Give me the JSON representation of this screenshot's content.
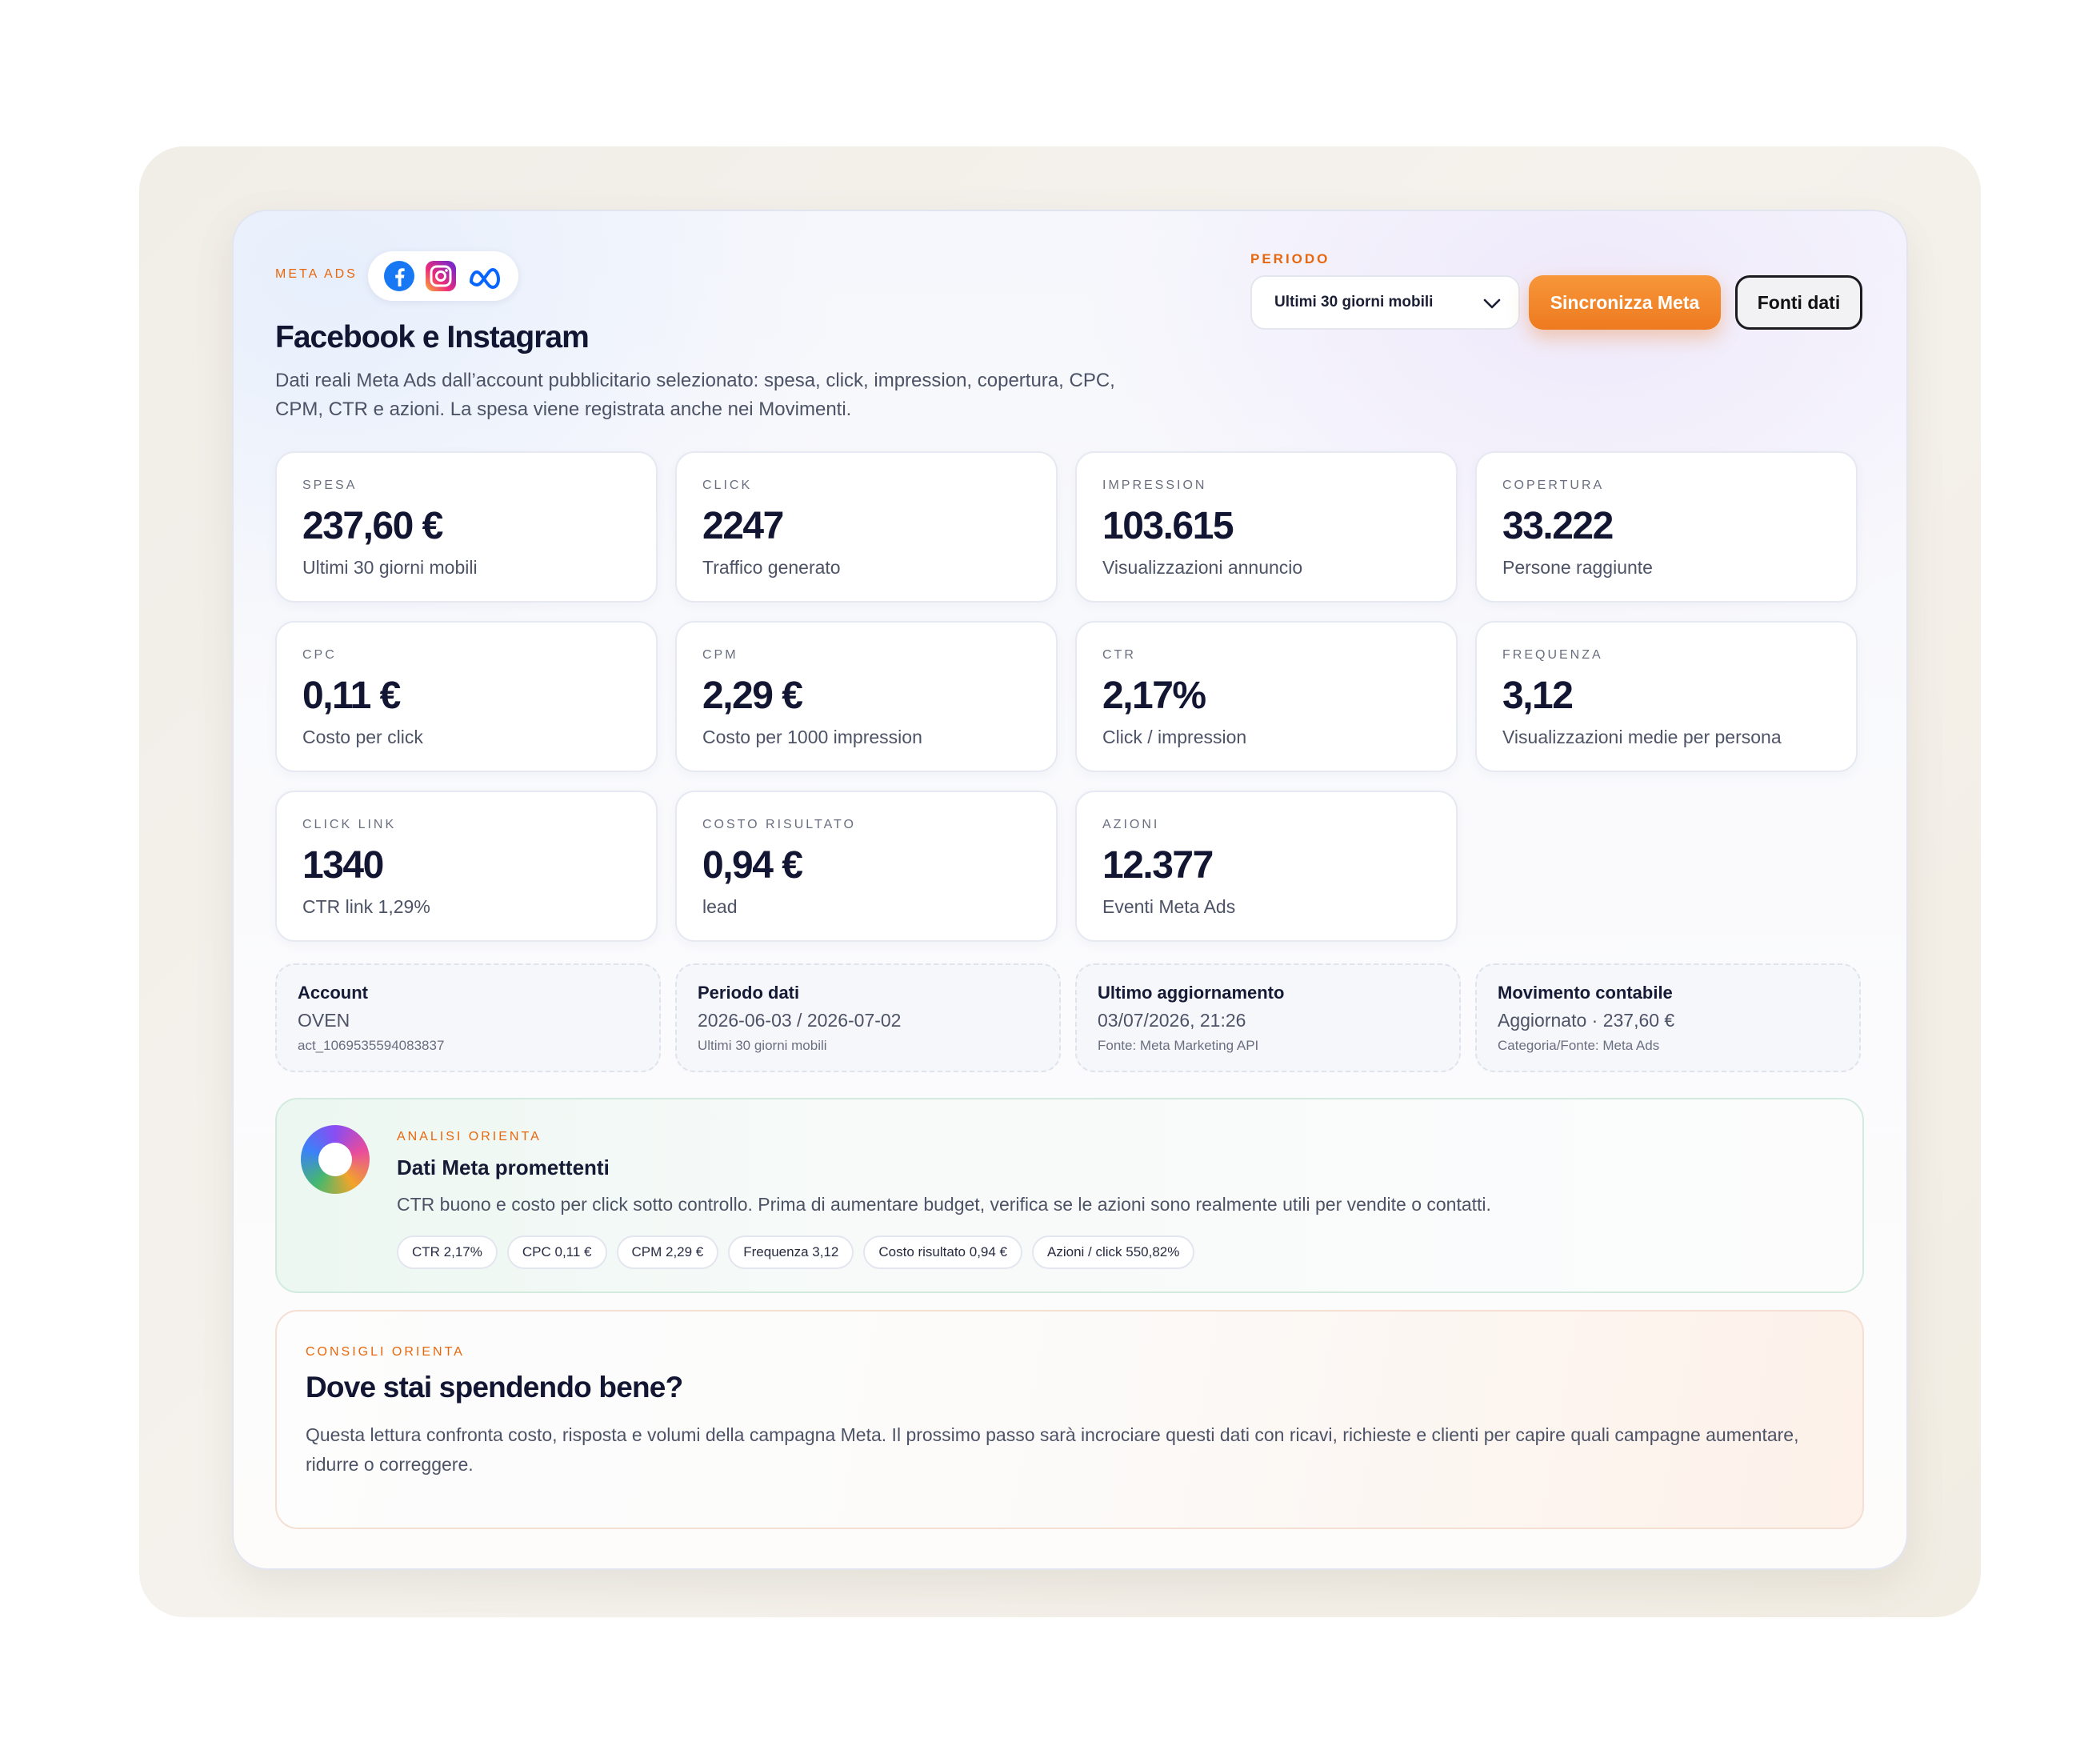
{
  "header": {
    "eyebrow": "META ADS",
    "logos": [
      "facebook-logo",
      "instagram-logo",
      "meta-logo"
    ],
    "title": "Facebook e Instagram",
    "description": "Dati reali Meta Ads dall’account pubblicitario selezionato: spesa, click, impression, copertura, CPC, CPM, CTR e azioni. La spesa viene registrata anche nei Movimenti."
  },
  "controls": {
    "periodo_label": "PERIODO",
    "periodo_value": "Ultimi 30 giorni mobili",
    "sync_label": "Sincronizza Meta",
    "fonti_label": "Fonti dati"
  },
  "kpis": [
    {
      "label": "SPESA",
      "value": "237,60 €",
      "sub": "Ultimi 30 giorni mobili"
    },
    {
      "label": "CLICK",
      "value": "2247",
      "sub": "Traffico generato"
    },
    {
      "label": "IMPRESSION",
      "value": "103.615",
      "sub": "Visualizzazioni annuncio"
    },
    {
      "label": "COPERTURA",
      "value": "33.222",
      "sub": "Persone raggiunte"
    },
    {
      "label": "CPC",
      "value": "0,11 €",
      "sub": "Costo per click"
    },
    {
      "label": "CPM",
      "value": "2,29 €",
      "sub": "Costo per 1000 impression"
    },
    {
      "label": "CTR",
      "value": "2,17%",
      "sub": "Click / impression"
    },
    {
      "label": "FREQUENZA",
      "value": "3,12",
      "sub": "Visualizzazioni medie per persona"
    },
    {
      "label": "CLICK LINK",
      "value": "1340",
      "sub": "CTR link 1,29%"
    },
    {
      "label": "COSTO RISULTATO",
      "value": "0,94 €",
      "sub": "lead"
    },
    {
      "label": "AZIONI",
      "value": "12.377",
      "sub": "Eventi Meta Ads"
    }
  ],
  "info": [
    {
      "title": "Account",
      "value": "OVEN",
      "small": "act_1069535594083837"
    },
    {
      "title": "Periodo dati",
      "value": "2026-06-03 / 2026-07-02",
      "small": "Ultimi 30 giorni mobili"
    },
    {
      "title": "Ultimo aggiornamento",
      "value": "03/07/2026, 21:26",
      "small": "Fonte: Meta Marketing API"
    },
    {
      "title": "Movimento contabile",
      "value": "Aggiornato · 237,60 €",
      "small": "Categoria/Fonte: Meta Ads"
    }
  ],
  "analysis": {
    "eyebrow": "ANALISI ORIENTA",
    "title": "Dati Meta promettenti",
    "text": "CTR buono e costo per click sotto controllo. Prima di aumentare budget, verifica se le azioni sono realmente utili per vendite o contatti.",
    "chips": [
      "CTR 2,17%",
      "CPC 0,11 €",
      "CPM 2,29 €",
      "Frequenza 3,12",
      "Costo risultato 0,94 €",
      "Azioni / click 550,82%"
    ]
  },
  "advice": {
    "eyebrow": "CONSIGLI ORIENTA",
    "title": "Dove stai spendendo bene?",
    "text": "Questa lettura confronta costo, risposta e volumi della campagna Meta. Il prossimo passo sarà incrociare questi dati con ricavi, richieste e clienti per capire quali campagne aumentare, ridurre o correggere."
  },
  "colors": {
    "accent": "#ee7a1f",
    "text": "#121633",
    "muted": "#4d5366"
  }
}
